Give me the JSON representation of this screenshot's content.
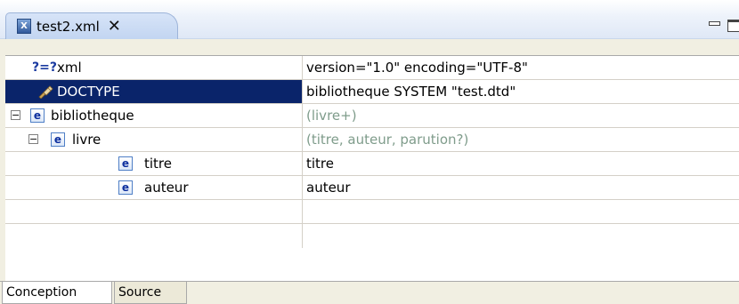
{
  "tab": {
    "title": "test2.xml",
    "icon": "xml-file-icon"
  },
  "rows": [
    {
      "name": "xml",
      "value": "version=\"1.0\" encoding=\"UTF-8\"",
      "icon": "processing-instruction-icon",
      "icon_text": "?=?"
    },
    {
      "name": "DOCTYPE",
      "value": "bibliotheque SYSTEM \"test.dtd\"",
      "icon": "doctype-icon",
      "selected": true
    },
    {
      "name": "bibliotheque",
      "value": "(livre+)",
      "icon": "element-icon",
      "icon_text": "e",
      "expander": "−"
    },
    {
      "name": "livre",
      "value": "(titre, auteur, parution?)",
      "icon": "element-icon",
      "icon_text": "e",
      "expander": "−"
    },
    {
      "name": "titre",
      "value": "titre",
      "icon": "element-icon",
      "icon_text": "e"
    },
    {
      "name": "auteur",
      "value": "auteur",
      "icon": "element-icon",
      "icon_text": "e"
    }
  ],
  "bottom_tabs": {
    "design": "Conception",
    "source": "Source",
    "active": "design"
  },
  "colors": {
    "selection": "#0a246a",
    "content_model_text": "#7f9c8b",
    "tab_fill": "#c2d5f1"
  }
}
